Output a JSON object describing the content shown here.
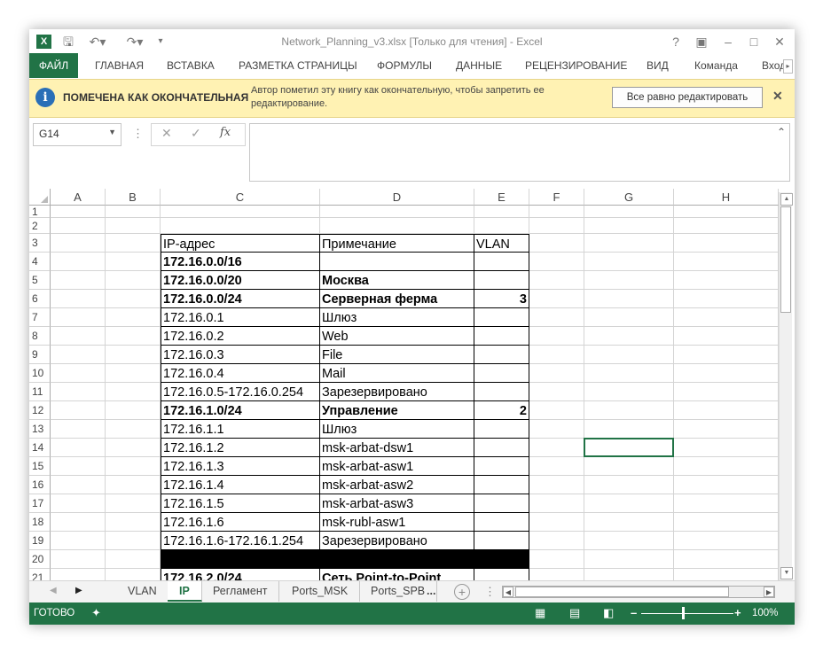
{
  "window": {
    "title": "Network_Planning_v3.xlsx  [Только для чтения] - Excel",
    "app_icon": "X"
  },
  "ribbon": {
    "tabs": [
      "ФАЙЛ",
      "ГЛАВНАЯ",
      "ВСТАВКА",
      "РАЗМЕТКА СТРАНИЦЫ",
      "ФОРМУЛЫ",
      "ДАННЫЕ",
      "РЕЦЕНЗИРОВАНИЕ",
      "ВИД",
      "Команда",
      "Вход"
    ]
  },
  "infobar": {
    "title": "ПОМЕЧЕНА КАК ОКОНЧАТЕЛЬНАЯ",
    "message": "Автор пометил эту книгу как окончательную, чтобы запретить ее редактирование.",
    "button": "Все равно редактировать"
  },
  "formula_bar": {
    "name_box": "G14",
    "formula": "",
    "fx_label": "fx"
  },
  "sheet": {
    "columns": [
      "A",
      "B",
      "C",
      "D",
      "E",
      "F",
      "G",
      "H"
    ],
    "rows": [
      {
        "n": "1"
      },
      {
        "n": "2"
      },
      {
        "n": "3",
        "c": "IP-адрес",
        "d": "Примечание",
        "e": "VLAN"
      },
      {
        "n": "4",
        "c": "172.16.0.0/16",
        "bold": true
      },
      {
        "n": "5",
        "c": "172.16.0.0/20",
        "d": "Москва",
        "bold": true
      },
      {
        "n": "6",
        "c": "172.16.0.0/24",
        "d": "Серверная ферма",
        "e": "3",
        "bold": true
      },
      {
        "n": "7",
        "c": "172.16.0.1",
        "d": "Шлюз"
      },
      {
        "n": "8",
        "c": "172.16.0.2",
        "d": "Web"
      },
      {
        "n": "9",
        "c": "172.16.0.3",
        "d": "File"
      },
      {
        "n": "10",
        "c": "172.16.0.4",
        "d": "Mail"
      },
      {
        "n": "11",
        "c": "172.16.0.5-172.16.0.254",
        "d": "Зарезервировано"
      },
      {
        "n": "12",
        "c": "172.16.1.0/24",
        "d": "Управление",
        "e": "2",
        "bold": true
      },
      {
        "n": "13",
        "c": "172.16.1.1",
        "d": "Шлюз"
      },
      {
        "n": "14",
        "c": "172.16.1.2",
        "d": "msk-arbat-dsw1"
      },
      {
        "n": "15",
        "c": "172.16.1.3",
        "d": "msk-arbat-asw1"
      },
      {
        "n": "16",
        "c": "172.16.1.4",
        "d": "msk-arbat-asw2"
      },
      {
        "n": "17",
        "c": "172.16.1.5",
        "d": "msk-arbat-asw3"
      },
      {
        "n": "18",
        "c": "172.16.1.6",
        "d": "msk-rubl-asw1"
      },
      {
        "n": "19",
        "c": "172.16.1.6-172.16.1.254",
        "d": "Зарезервировано"
      },
      {
        "n": "20",
        "black": true
      },
      {
        "n": "21",
        "c": "172.16.2.0/24",
        "d": "Сеть Point-to-Point",
        "bold": true
      }
    ]
  },
  "sheet_tabs": {
    "tabs": [
      "VLAN",
      "IP",
      "Регламент",
      "Ports_MSK",
      "Ports_SPB",
      "..."
    ],
    "active": "IP"
  },
  "status": {
    "ready": "ГОТОВО",
    "zoom": "100%"
  },
  "colors": {
    "excel_green": "#217346",
    "info_yellow": "#fff2b3"
  }
}
